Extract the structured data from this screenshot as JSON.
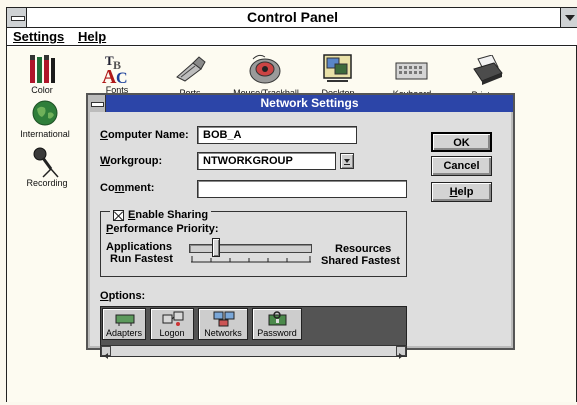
{
  "control_panel": {
    "title": "Control Panel",
    "menu": [
      "Settings",
      "Help"
    ],
    "icons": [
      {
        "label": "Color",
        "icon": "color-icon"
      },
      {
        "label": "Fonts",
        "icon": "fonts-icon"
      },
      {
        "label": "Ports",
        "icon": "ports-icon"
      },
      {
        "label": "Mouse/Trackball",
        "icon": "mouse-icon"
      },
      {
        "label": "Desktop",
        "icon": "desktop-icon"
      },
      {
        "label": "Keyboard",
        "icon": "keyboard-icon"
      },
      {
        "label": "Printers",
        "icon": "printers-icon"
      },
      {
        "label": "International",
        "icon": "globe-icon"
      },
      {
        "label": "Recording",
        "icon": "microphone-icon"
      }
    ]
  },
  "dialog": {
    "title": "Network Settings",
    "computer_name": {
      "label": "Computer Name:",
      "value": "BOB_A"
    },
    "workgroup": {
      "label": "Workgroup:",
      "value": "NTWORKGROUP"
    },
    "comment": {
      "label": "Comment:",
      "value": ""
    },
    "buttons": {
      "ok": "OK",
      "cancel": "Cancel",
      "help": "Help"
    },
    "sharing": {
      "checkbox_label": "Enable Sharing",
      "checked": true,
      "priority_label": "Performance Priority:",
      "left_label_1": "Applications",
      "left_label_2": "Run Fastest",
      "right_label_1": "Resources",
      "right_label_2": "Shared Fastest",
      "slider_position": 0.2
    },
    "options": {
      "label": "Options:",
      "items": [
        {
          "label": "Adapters",
          "icon": "adapters-icon"
        },
        {
          "label": "Logon",
          "icon": "logon-icon"
        },
        {
          "label": "Networks",
          "icon": "networks-icon"
        },
        {
          "label": "Password",
          "icon": "password-icon"
        }
      ]
    }
  },
  "colors": {
    "dialog_title_bar": "#2c45a8",
    "dialog_face": "#dedede"
  }
}
